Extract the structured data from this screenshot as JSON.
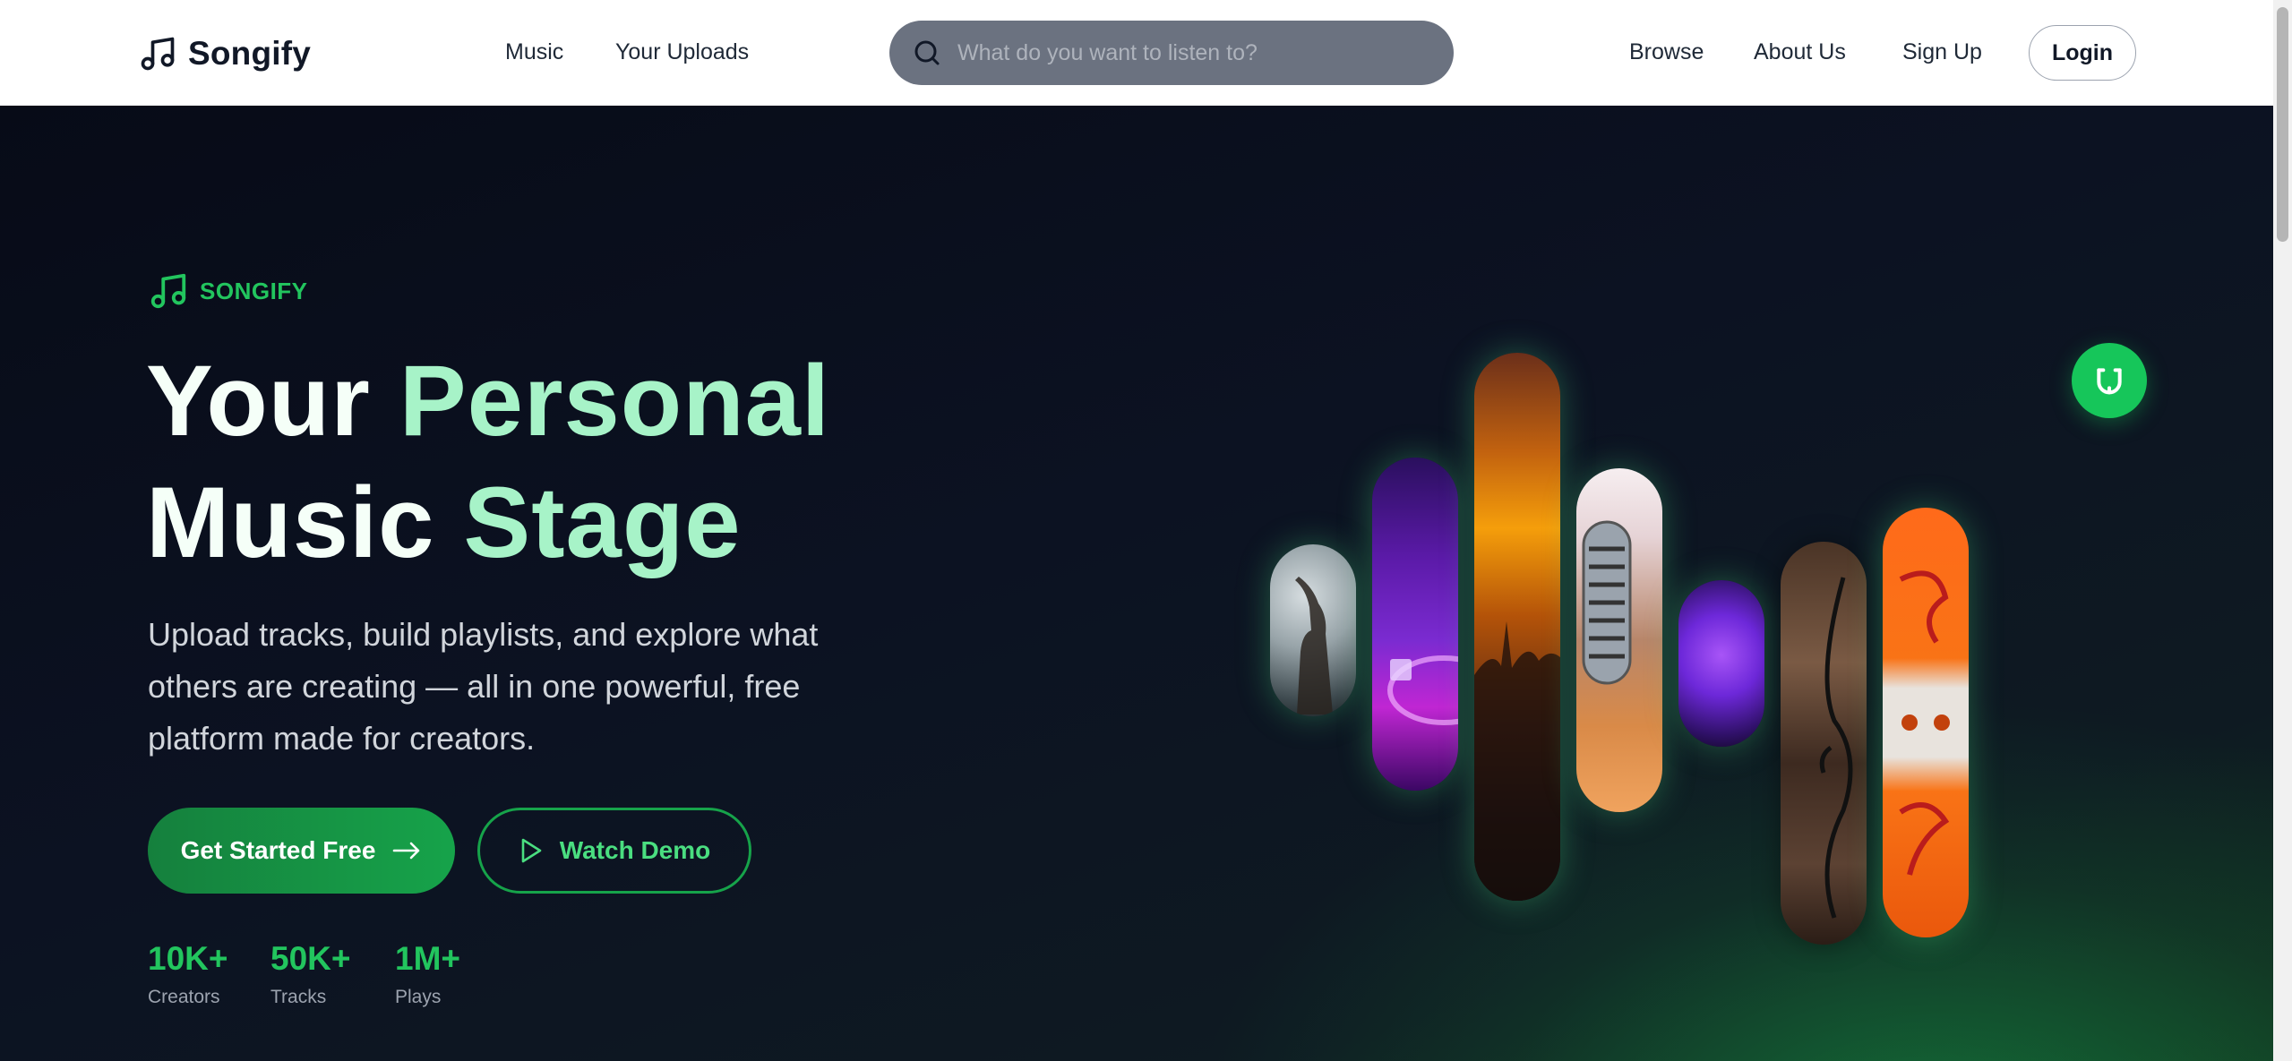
{
  "brand": {
    "name": "Songify"
  },
  "nav": {
    "links_left": [
      "Music",
      "Your Uploads"
    ],
    "links_right": [
      "Browse",
      "About Us",
      "Sign Up"
    ],
    "login_label": "Login"
  },
  "search": {
    "placeholder": "What do you want to listen to?"
  },
  "hero": {
    "eyebrow": "SONGIFY",
    "title_line1_white": "Your ",
    "title_line1_accent": "Personal",
    "title_line2_white": "Music ",
    "title_line2_accent": "Stage",
    "description": "Upload tracks, build playlists, and explore what others are creating — all in one powerful, free platform made for creators.",
    "cta_primary": "Get Started Free",
    "cta_secondary": "Watch Demo",
    "stats": [
      {
        "value": "10K+",
        "label": "Creators"
      },
      {
        "value": "50K+",
        "label": "Tracks"
      },
      {
        "value": "1M+",
        "label": "Plays"
      }
    ]
  },
  "images": [
    {
      "name": "concert-performer-photo"
    },
    {
      "name": "dj-turntable-photo"
    },
    {
      "name": "concert-crowd-photo"
    },
    {
      "name": "microphone-photo"
    },
    {
      "name": "festival-stage-photo"
    },
    {
      "name": "guitar-photo"
    },
    {
      "name": "cassette-tape-photo"
    }
  ],
  "icons": {
    "brand": "music-note-icon",
    "search": "search-icon",
    "eyebrow": "music-note-icon",
    "cta_primary": "arrow-right-icon",
    "cta_secondary": "play-icon",
    "fab": "headphones-icon"
  },
  "colors": {
    "accent": "#22c55e",
    "accent_light": "#a7f3c8",
    "background": "#0b0f1c"
  }
}
